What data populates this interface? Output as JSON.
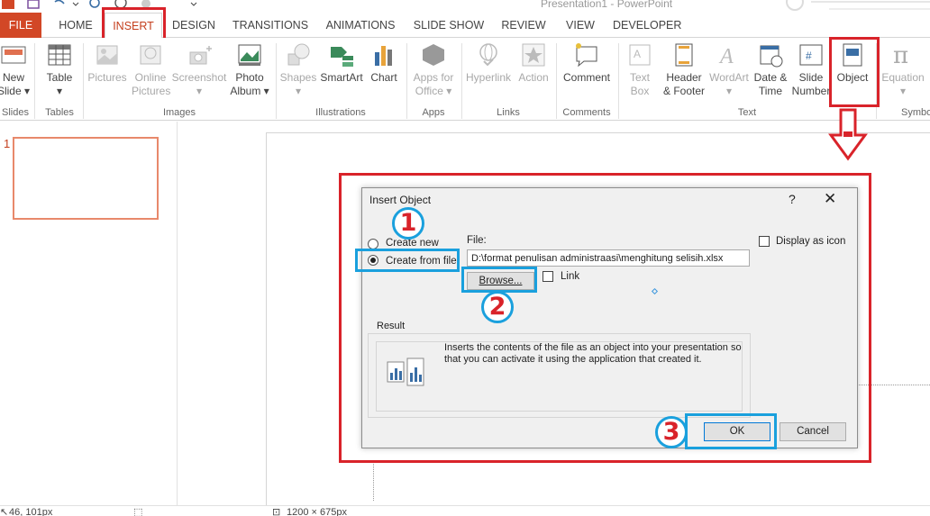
{
  "window": {
    "title": "Presentation1 - PowerPoint"
  },
  "tabs": [
    {
      "label": "FILE"
    },
    {
      "label": "HOME"
    },
    {
      "label": "INSERT"
    },
    {
      "label": "DESIGN"
    },
    {
      "label": "TRANSITIONS"
    },
    {
      "label": "ANIMATIONS"
    },
    {
      "label": "SLIDE SHOW"
    },
    {
      "label": "REVIEW"
    },
    {
      "label": "VIEW"
    },
    {
      "label": "DEVELOPER"
    }
  ],
  "ribbon": {
    "buttons": {
      "new_slide": [
        "New",
        "Slide ▾"
      ],
      "table": [
        "Table",
        "▾"
      ],
      "pictures": [
        "Pictures"
      ],
      "online_pictures": [
        "Online",
        "Pictures"
      ],
      "screenshot": [
        "Screenshot",
        "▾"
      ],
      "photo_album": [
        "Photo",
        "Album ▾"
      ],
      "shapes": [
        "Shapes",
        "▾"
      ],
      "smartart": [
        "SmartArt"
      ],
      "chart": [
        "Chart"
      ],
      "apps_for_office": [
        "Apps for",
        "Office ▾"
      ],
      "hyperlink": [
        "Hyperlink"
      ],
      "action": [
        "Action"
      ],
      "comment": [
        "Comment"
      ],
      "text_box": [
        "Text",
        "Box"
      ],
      "header_footer": [
        "Header",
        "& Footer"
      ],
      "wordart": [
        "WordArt",
        "▾"
      ],
      "date_time": [
        "Date &",
        "Time"
      ],
      "slide_number": [
        "Slide",
        "Number"
      ],
      "object": [
        "Object"
      ],
      "equation": [
        "Equation",
        "▾"
      ]
    },
    "groups": {
      "slides": "Slides",
      "tables": "Tables",
      "images": "Images",
      "illustrations": "Illustrations",
      "apps": "Apps",
      "links": "Links",
      "comments": "Comments",
      "text": "Text",
      "symbols": "Symbo"
    }
  },
  "thumbnails": {
    "slide_number": "1"
  },
  "status": {
    "cursor": "46, 101px",
    "size": "1200 × 675px"
  },
  "dialog": {
    "title": "Insert Object",
    "help": "?",
    "close": "✕",
    "create_new_label": "Create new",
    "create_from_file_label": "Create from file",
    "file_label": "File:",
    "file_value": "D:\\format penulisan administraasi\\menghitung selisih.xlsx",
    "browse_label": "Browse...",
    "link_label": "Link",
    "display_as_icon_label": "Display as icon",
    "result_title": "Result",
    "result_text": "Inserts the contents of the file as an object into your presentation so that you can activate it using the application that created it.",
    "ok_label": "OK",
    "cancel_label": "Cancel",
    "selected_option": "create_from_file"
  },
  "annotations": {
    "step1": "1",
    "step2": "2",
    "step3": "3"
  },
  "colors": {
    "accent": "#d24726",
    "annotation_red": "#d9232a",
    "annotation_blue": "#1aa0dd"
  }
}
